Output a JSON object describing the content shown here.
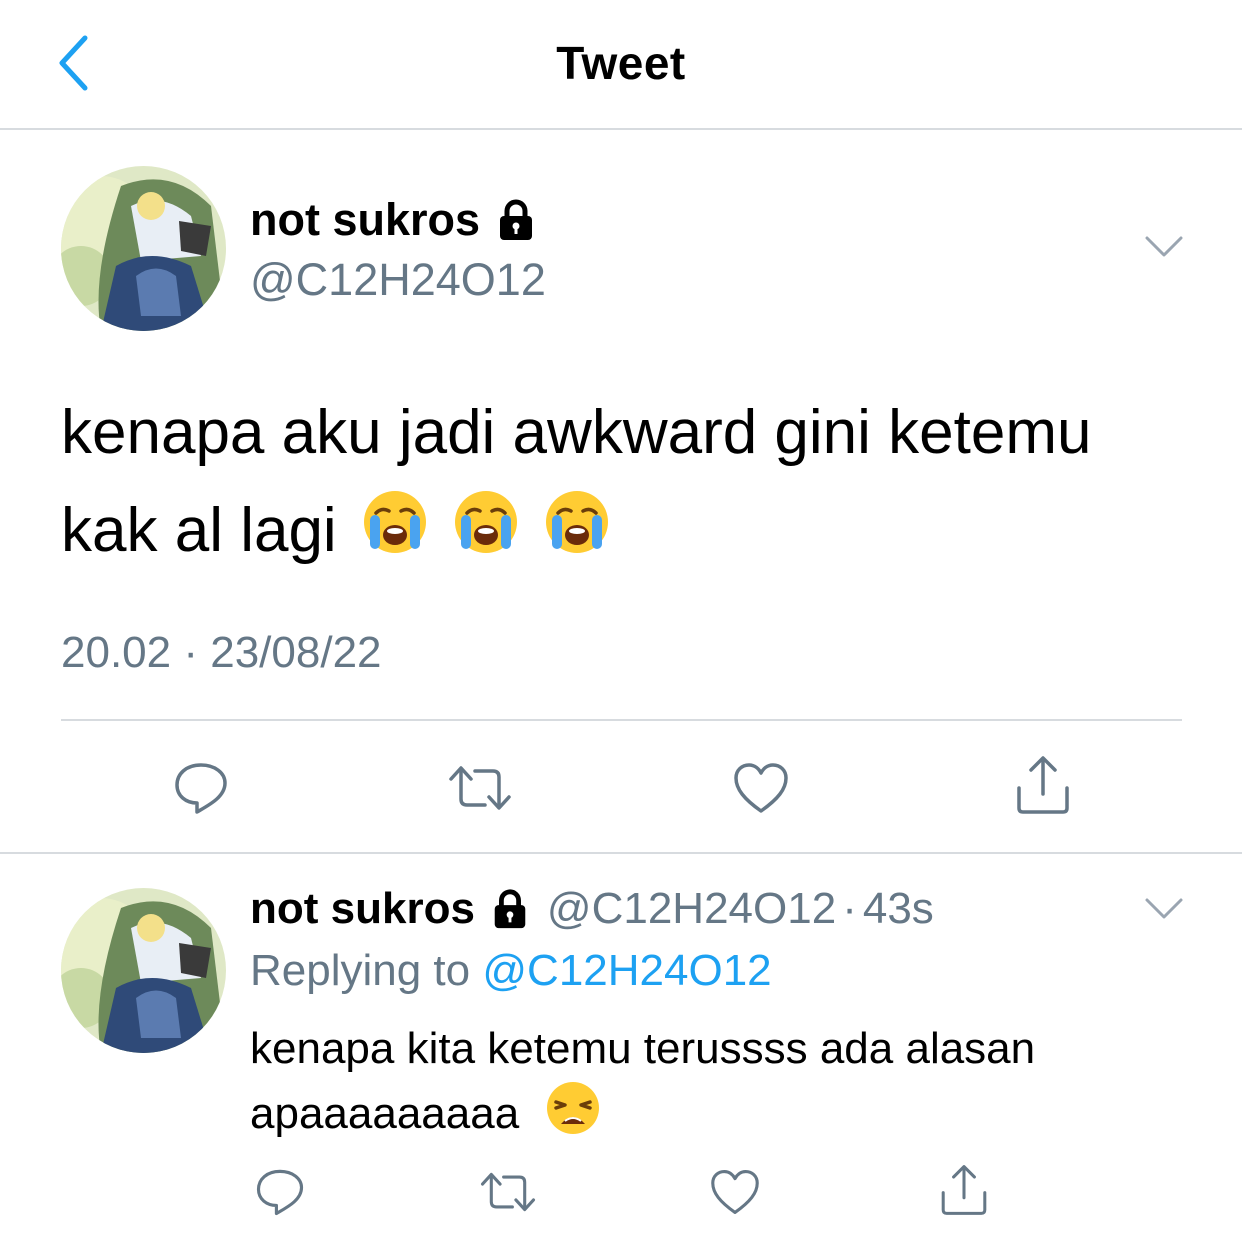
{
  "header": {
    "title": "Tweet"
  },
  "colors": {
    "accent": "#1da1f2",
    "muted": "#657786",
    "divider": "#d7dbdf"
  },
  "tweet": {
    "display_name": "not sukros",
    "handle": "@C12H24O12",
    "text": "kenapa aku jadi awkward gini ketemu kak al lagi",
    "emojis": [
      "loudly-crying-face",
      "loudly-crying-face",
      "loudly-crying-face"
    ],
    "time": "20.02",
    "separator": "·",
    "date": "23/08/22"
  },
  "reply": {
    "display_name": "not sukros",
    "handle": "@C12H24O12",
    "dot": "·",
    "age": "43s",
    "replying_prefix": "Replying to",
    "replying_to": "@C12H24O12",
    "text": "kenapa kita ketemu terussss ada alasan apaaaaaaaaa",
    "emoji": "weary-face"
  },
  "icons": [
    "back-chevron-icon",
    "lock-icon",
    "chevron-down-icon",
    "reply-icon",
    "retweet-icon",
    "like-icon",
    "share-icon"
  ]
}
